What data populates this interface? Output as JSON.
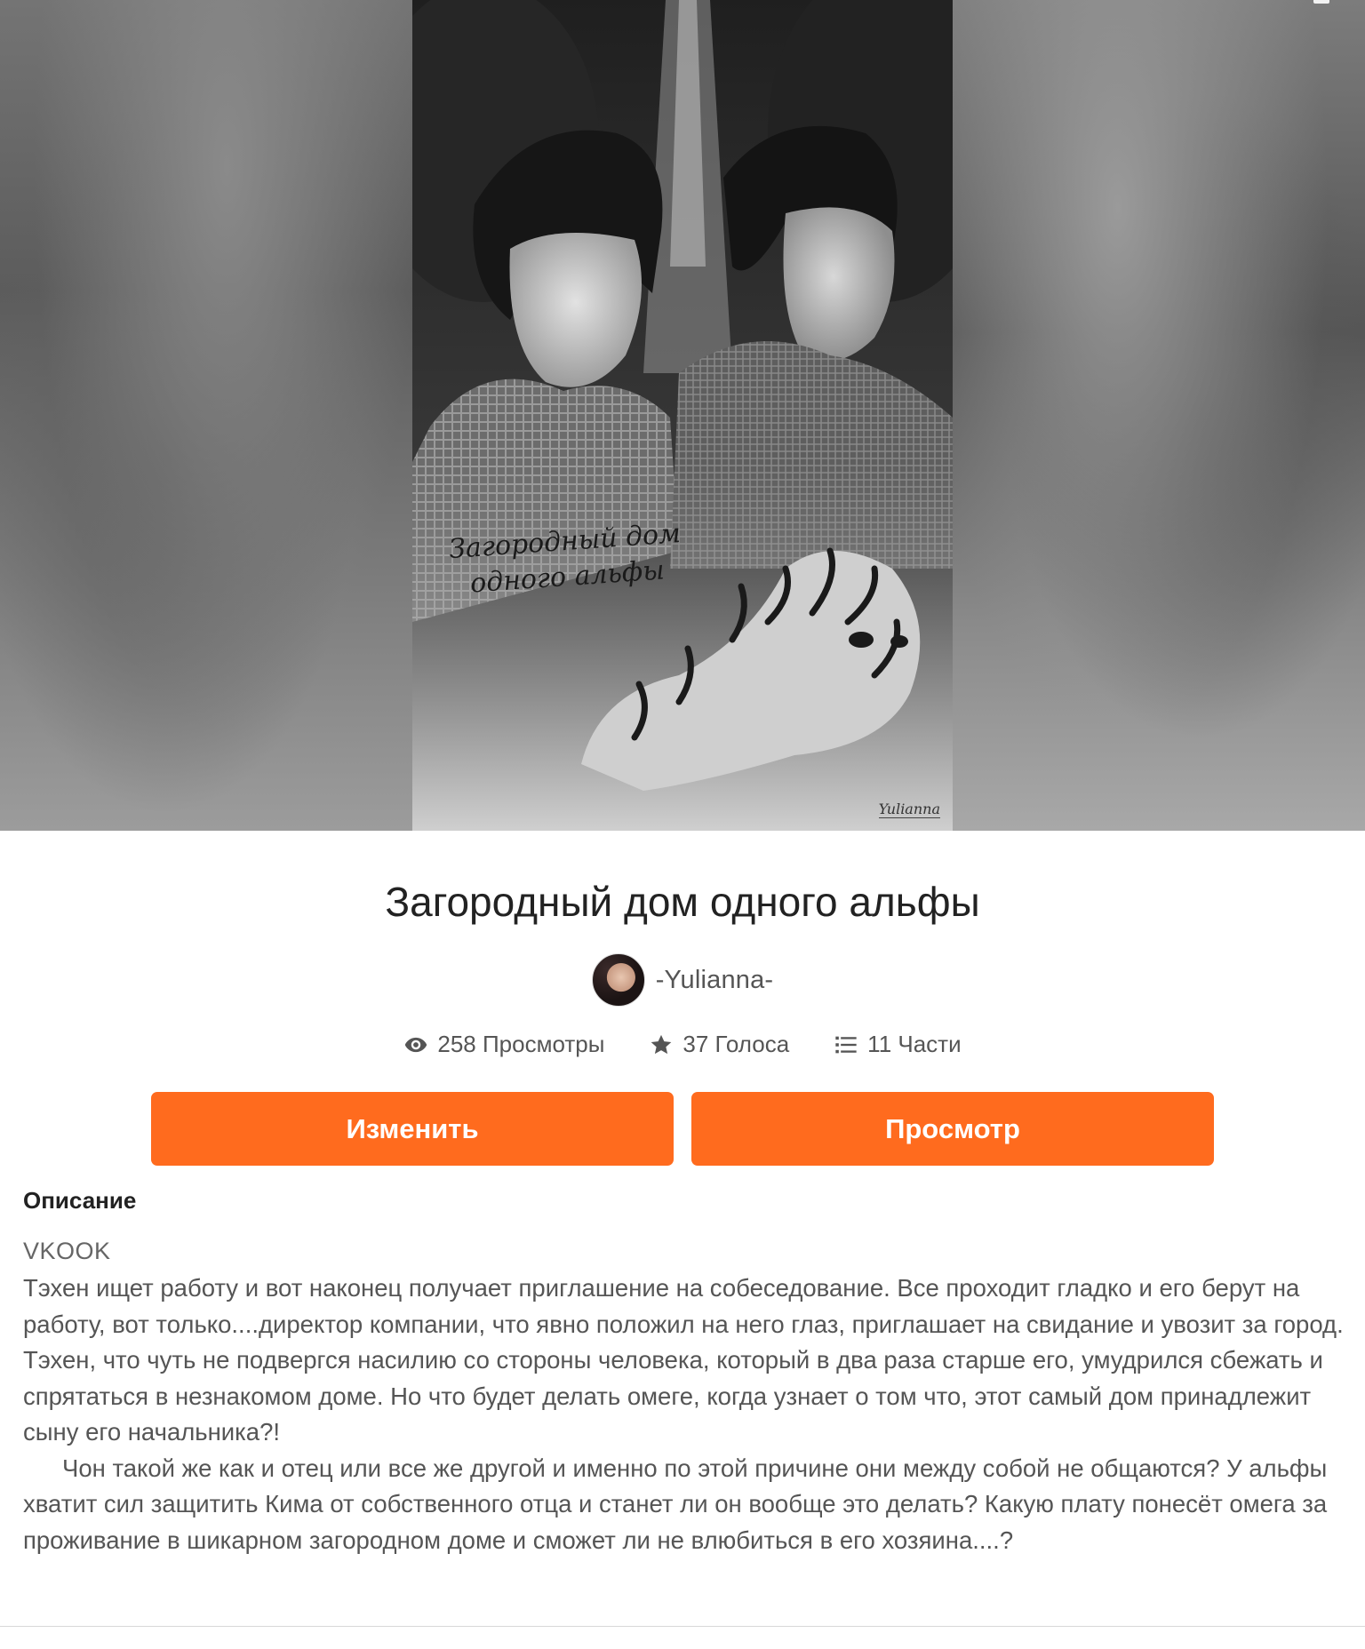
{
  "story": {
    "title": "Загородный дом одного альфы",
    "cover_title_text": "Загородный дом одного альфы",
    "cover_signature": "Yulianna",
    "author": "-Yulianna-",
    "stats": {
      "views": "258 Просмотры",
      "votes": "37 Голоса",
      "parts": "11 Части"
    }
  },
  "actions": {
    "edit_label": "Изменить",
    "view_label": "Просмотр"
  },
  "description": {
    "heading": "Описание",
    "tag": "VKOOK",
    "paragraph1": "Тэхен ищет работу и вот наконец получает приглашение на собеседование. Все проходит гладко и его берут на работу, вот только....директор компании, что явно положил на него глаз, приглашает на свидание и увозит за город. Тэхен, что чуть не подвергся насилию со стороны человека, который в два раза старше его, умудрился сбежать и спрятаться в незнакомом доме. Но что будет делать омеге, когда узнает о том что, этот самый дом принадлежит сыну его начальника?!",
    "paragraph2": "Чон такой же как и отец или все же другой и именно по этой причине они между собой не общаются? У альфы хватит сил защитить Кима от собственного отца и станет ли он вообще это делать? Какую плату понесёт омега за проживание в шикарном загородном доме и сможет ли не влюбиться в его хозяина....?"
  },
  "colors": {
    "accent": "#ff6b1e",
    "text_primary": "#222222",
    "text_secondary": "#555555"
  },
  "icons": {
    "views": "eye-icon",
    "votes": "star-icon",
    "parts": "list-icon"
  }
}
